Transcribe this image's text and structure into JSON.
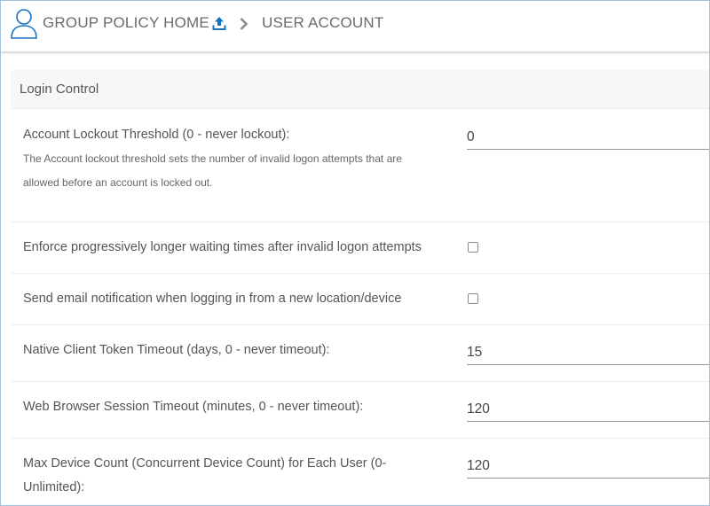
{
  "header": {
    "home_label": "GROUP POLICY HOME",
    "current_label": "USER ACCOUNT",
    "accent_color": "#1672c0"
  },
  "section": {
    "title": "Login Control"
  },
  "settings": {
    "lockout_threshold": {
      "label": "Account Lockout Threshold (0 - never lockout):",
      "description_line1": "The Account lockout threshold sets the number of invalid logon attempts that are",
      "description_line2": "allowed before an account is locked out.",
      "value": "0"
    },
    "progressive_wait": {
      "label": "Enforce progressively longer waiting times after invalid logon attempts",
      "checked": false
    },
    "email_notification": {
      "label": "Send email notification when logging in from a new location/device",
      "checked": false
    },
    "native_token_timeout": {
      "label": "Native Client Token Timeout (days, 0 - never timeout):",
      "value": "15"
    },
    "web_session_timeout": {
      "label": "Web Browser Session Timeout (minutes, 0 - never timeout):",
      "value": "120"
    },
    "max_device_count": {
      "label_line1": "Max Device Count (Concurrent Device Count) for Each User (0-",
      "label_line2": "Unlimited):",
      "value": "120"
    }
  }
}
